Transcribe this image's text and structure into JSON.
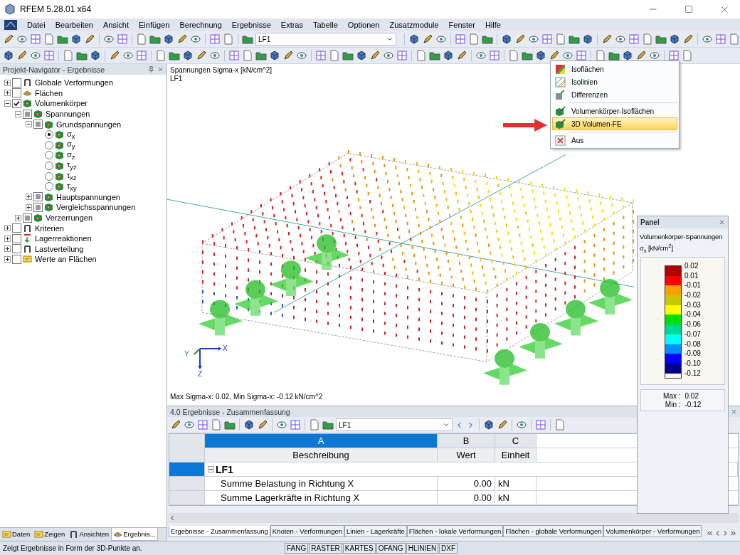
{
  "window": {
    "title": "RFEM 5.28.01 x64"
  },
  "menu": [
    "Datei",
    "Bearbeiten",
    "Ansicht",
    "Einfügen",
    "Berechnung",
    "Ergebnisse",
    "Extras",
    "Tabelle",
    "Optionen",
    "Zusatzmodule",
    "Fenster",
    "Hilfe"
  ],
  "toolbar": {
    "loadcase": "LF1"
  },
  "navigator": {
    "title": "Projekt-Navigator - Ergebnisse",
    "tree": [
      {
        "label": "Globale Verformungen",
        "kind": "checkbox",
        "checked": false,
        "partial": false,
        "expanded": false
      },
      {
        "label": "Flächen",
        "kind": "checkbox",
        "checked": false,
        "partial": false,
        "expanded": false
      },
      {
        "label": "Volumenkörper",
        "kind": "checkbox",
        "checked": true,
        "partial": false,
        "expanded": true,
        "children": [
          {
            "label": "Spannungen",
            "kind": "checkbox",
            "checked": false,
            "partial": true,
            "expanded": true,
            "children": [
              {
                "label": "Grundspannungen",
                "kind": "checkbox",
                "checked": false,
                "partial": true,
                "expanded": true,
                "children": [
                  {
                    "label": "σ$_{x}$",
                    "kind": "radio",
                    "selected": true
                  },
                  {
                    "label": "σ$_{y}$",
                    "kind": "radio",
                    "selected": false
                  },
                  {
                    "label": "σ$_{z}$",
                    "kind": "radio",
                    "selected": false
                  },
                  {
                    "label": "τ$_{yz}$",
                    "kind": "radio",
                    "selected": false
                  },
                  {
                    "label": "τ$_{xz}$",
                    "kind": "radio",
                    "selected": false
                  },
                  {
                    "label": "τ$_{xy}$",
                    "kind": "radio",
                    "selected": false
                  }
                ]
              },
              {
                "label": "Hauptspannungen",
                "kind": "checkbox",
                "checked": false,
                "partial": true,
                "expanded": false
              },
              {
                "label": "Vergleichsspannungen",
                "kind": "checkbox",
                "checked": false,
                "partial": true,
                "expanded": false
              }
            ]
          },
          {
            "label": "Verzerrungen",
            "kind": "checkbox",
            "checked": false,
            "partial": true,
            "expanded": false
          }
        ]
      },
      {
        "label": "Kriterien",
        "kind": "checkbox",
        "checked": false,
        "partial": false,
        "expanded": false
      },
      {
        "label": "Lagerreaktionen",
        "kind": "checkbox",
        "checked": false,
        "partial": false,
        "expanded": false
      },
      {
        "label": "Lastverteilung",
        "kind": "checkbox",
        "checked": false,
        "partial": false,
        "expanded": false
      },
      {
        "label": "Werte an Flächen",
        "kind": "checkbox",
        "checked": false,
        "partial": false,
        "expanded": false
      }
    ],
    "tabs": [
      {
        "label": "Daten",
        "selected": false
      },
      {
        "label": "Zeigen",
        "selected": false
      },
      {
        "label": "Ansichten",
        "selected": false
      },
      {
        "label": "Ergebnis...",
        "selected": true
      }
    ]
  },
  "viewport": {
    "heading": "Spannungen Sigma-x [kN/cm^2]",
    "loadcase": "LF1",
    "axes": [
      "X",
      "Y",
      "Z"
    ],
    "footer": "Max Sigma-x: 0.02, Min Sigma-x: -0.12 kN/cm^2"
  },
  "dropdown": {
    "groups": [
      [
        {
          "label": "Isoflächen",
          "selected": false
        },
        {
          "label": "Isolinien",
          "selected": false
        },
        {
          "label": "Differenzen",
          "selected": false
        }
      ],
      [
        {
          "label": "Volumenkörper-Isoflächen",
          "selected": false
        },
        {
          "label": "3D Volumen-FE",
          "selected": true
        }
      ],
      [
        {
          "label": "Aus",
          "selected": false
        }
      ]
    ]
  },
  "panel": {
    "title": "Panel",
    "heading": "Volumenkörper-Spannungen",
    "unit": "σ$_{x}$ [kN/cm$^{2}$]",
    "bands": [
      {
        "color": "#b00000"
      },
      {
        "color": "#ff0000"
      },
      {
        "color": "#ffa000"
      },
      {
        "color": "#c8c800"
      },
      {
        "color": "#ffff00"
      },
      {
        "color": "#00e000"
      },
      {
        "color": "#00d890"
      },
      {
        "color": "#00ffff"
      },
      {
        "color": "#0090ff"
      },
      {
        "color": "#0000ff"
      },
      {
        "color": "#00008c"
      }
    ],
    "ticks": [
      "0.02",
      "0.01",
      "-0.01",
      "-0.02",
      "-0.03",
      "-0.04",
      "-0.06",
      "-0.07",
      "-0.08",
      "-0.09",
      "-0.10",
      "-0.12"
    ],
    "max_label": "Max :",
    "max": "0.02",
    "min_label": "Min :",
    "min": "-0.12"
  },
  "results": {
    "title": "4.0 Ergebnisse - Zusammenfassung",
    "loadcase": "LF1",
    "columns": [
      {
        "letter": "A",
        "label": "Beschreibung",
        "selected": true
      },
      {
        "letter": "B",
        "label": "Wert",
        "selected": false
      },
      {
        "letter": "C",
        "label": "Einheit",
        "selected": false
      }
    ],
    "rows": [
      {
        "kind": "group",
        "label": "LF1",
        "expanded": true,
        "selected": true
      },
      {
        "kind": "item",
        "description": "Summe Belastung in Richtung X",
        "value": "0.00",
        "unit": "kN",
        "selected": false
      },
      {
        "kind": "item",
        "description": "Summe Lagerkräfte in Richtung X",
        "value": "0.00",
        "unit": "kN",
        "selected": false
      }
    ],
    "tabs": [
      {
        "label": "Ergebnisse - Zusammenfassung",
        "selected": true
      },
      {
        "label": "Knoten - Verformungen",
        "selected": false
      },
      {
        "label": "Linien - Lagerkräfte",
        "selected": false
      },
      {
        "label": "Flächen - lokale Verformungen",
        "selected": false
      },
      {
        "label": "Flächen - globale Verformungen",
        "selected": false
      },
      {
        "label": "Volumenkörper - Verformungen",
        "selected": false
      }
    ]
  },
  "status_bar": {
    "text": "Zeigt Ergebnisse in Form der 3D-Punkte an.",
    "toggles": [
      "FANG",
      "RASTER",
      "KARTES",
      "OFANG",
      "HLINIEN",
      "DXF"
    ]
  }
}
